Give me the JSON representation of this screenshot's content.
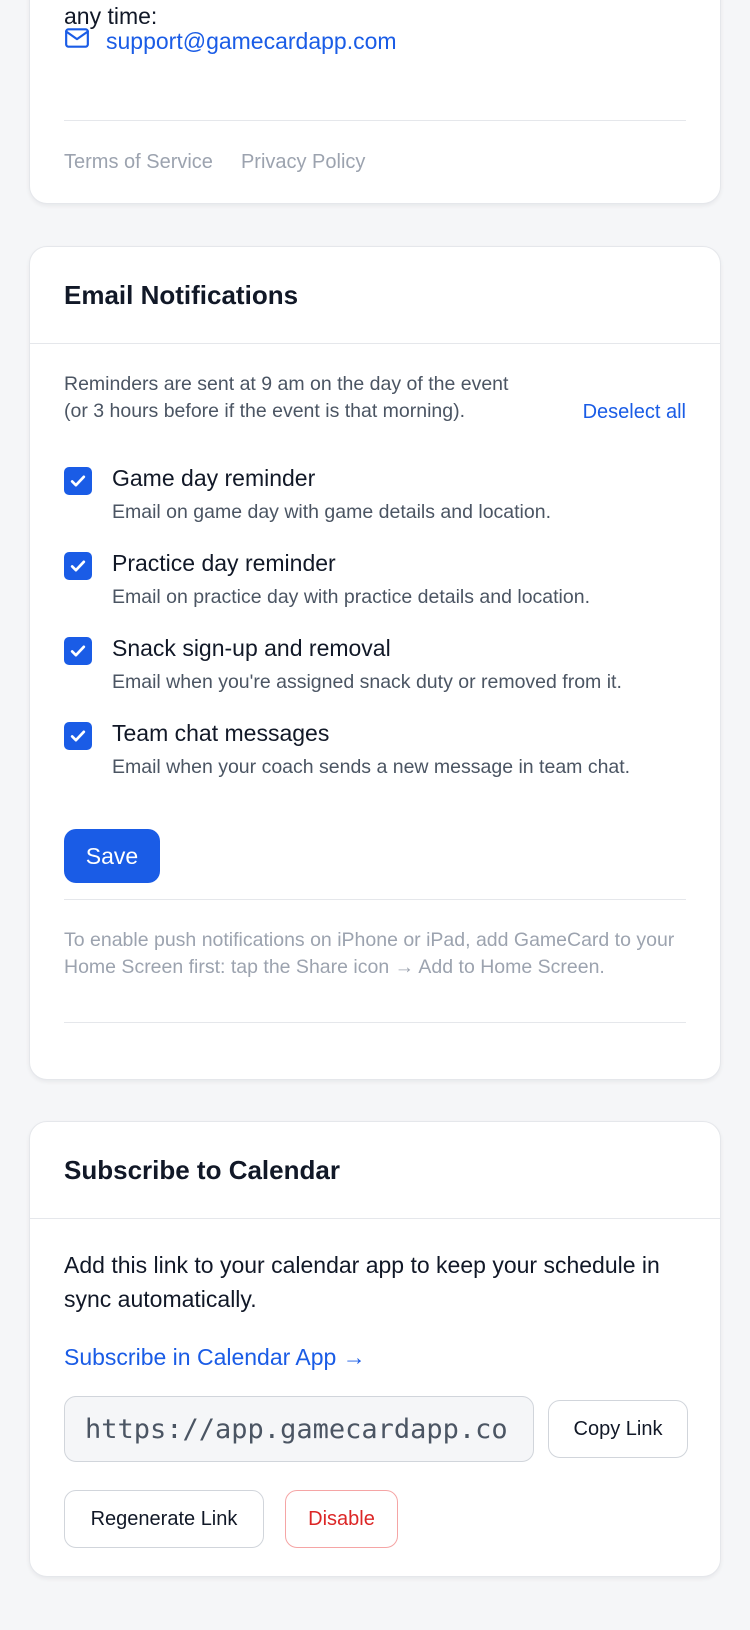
{
  "support": {
    "intro": "any time:",
    "email": "support@gamecardapp.com",
    "terms": "Terms of Service",
    "privacy": "Privacy Policy"
  },
  "email_notifications": {
    "title": "Email Notifications",
    "info": "Reminders are sent at 9 am on the day of the event (or 3 hours before if the event is that morning).",
    "deselect_all": "Deselect all",
    "items": [
      {
        "label": "Game day reminder",
        "desc": "Email on game day with game details and location.",
        "checked": true
      },
      {
        "label": "Practice day reminder",
        "desc": "Email on practice day with practice details and location.",
        "checked": true
      },
      {
        "label": "Snack sign-up and removal",
        "desc": "Email when you're assigned snack duty or removed from it.",
        "checked": true
      },
      {
        "label": "Team chat messages",
        "desc": "Email when your coach sends a new message in team chat.",
        "checked": true
      }
    ],
    "save": "Save",
    "push_hint": "To enable push notifications on iPhone or iPad, add GameCard to your Home Screen first: tap the Share icon → Add to Home Screen."
  },
  "calendar": {
    "title": "Subscribe to Calendar",
    "description": "Add this link to your calendar app to keep your schedule in sync automatically.",
    "subscribe_link": "Subscribe in Calendar App →",
    "url_value": "https://app.gamecardapp.co",
    "copy_link": "Copy Link",
    "regenerate": "Regenerate Link",
    "disable": "Disable"
  },
  "colors": {
    "accent": "#1a5ce6",
    "danger": "#dc2626",
    "muted": "#9ca3af"
  }
}
